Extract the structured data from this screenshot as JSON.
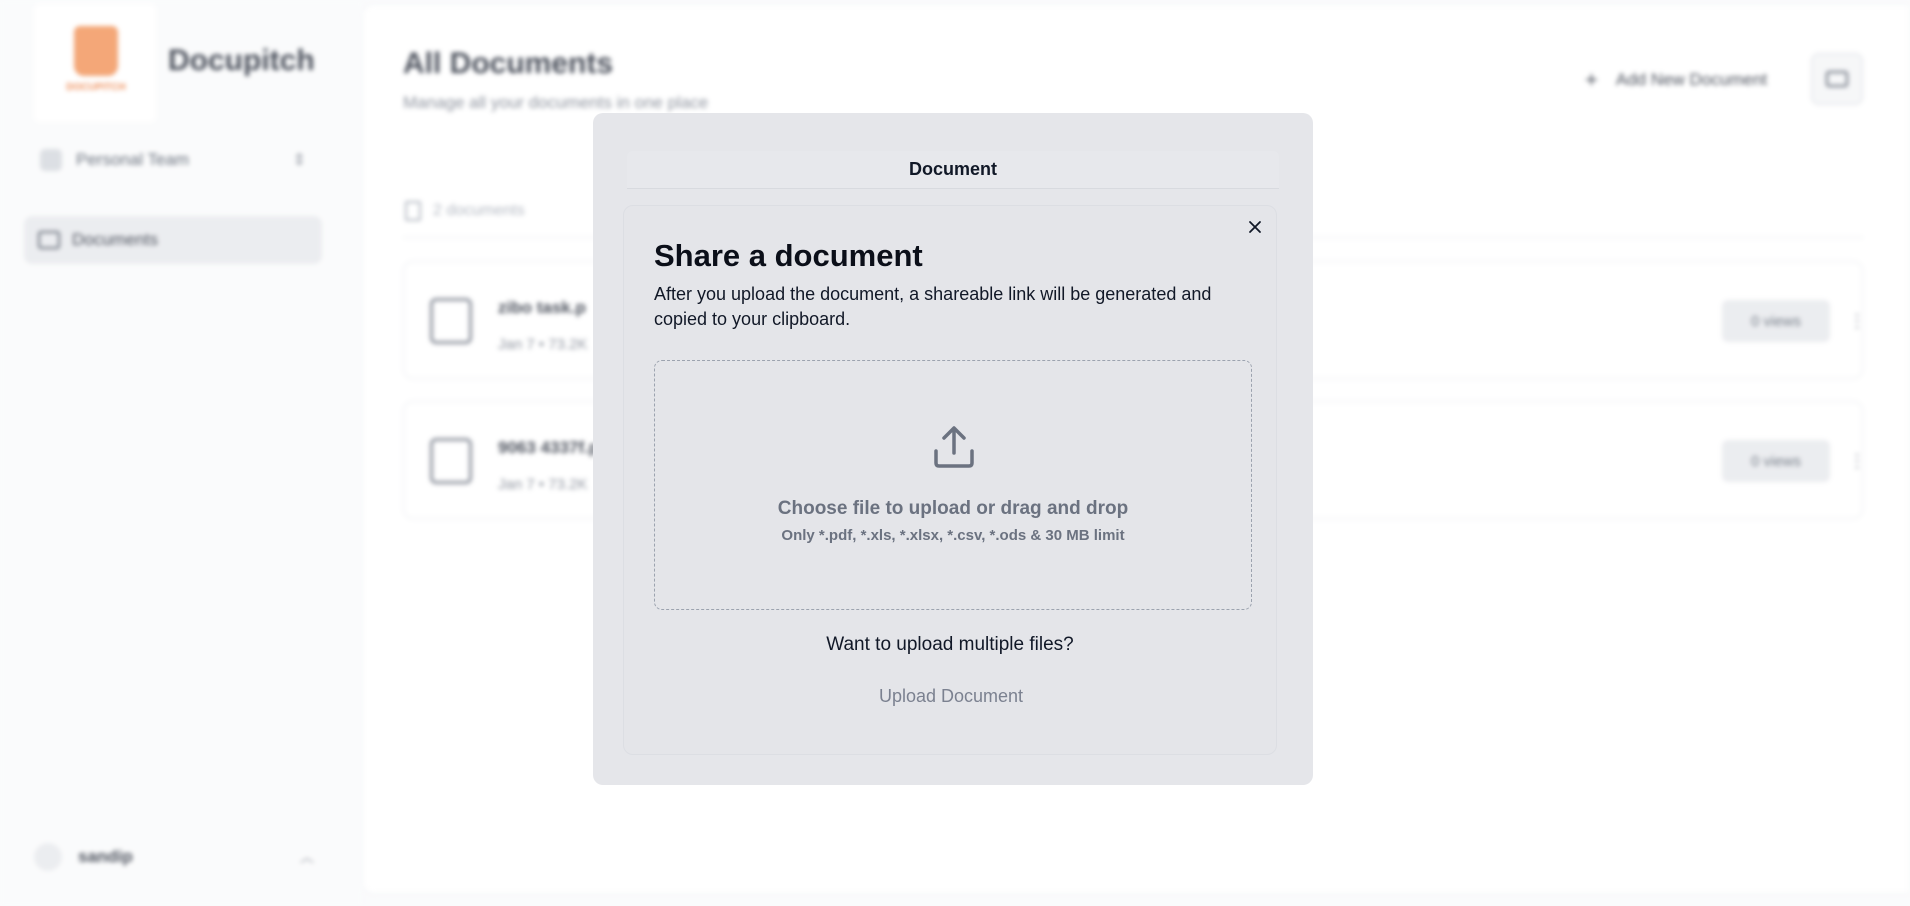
{
  "sidebar": {
    "brand": "Docupitch",
    "logo_text": "DOCUPITCH",
    "team": {
      "label": "Personal Team"
    },
    "nav": [
      {
        "label": "Documents"
      }
    ],
    "user": {
      "name": "sandip"
    }
  },
  "main": {
    "title": "All Documents",
    "subtitle": "Manage all your documents in one place",
    "add_button": "Add New Document",
    "doc_count": "2 documents",
    "documents": [
      {
        "name": "zibo task.p",
        "meta": "Jan 7 • 73.2K",
        "views": "0 views"
      },
      {
        "name": "9063 4337f.p",
        "meta": "Jan 7 • 73.2K",
        "views": "0 views"
      }
    ]
  },
  "modal": {
    "tab": "Document",
    "title": "Share a document",
    "description": "After you upload the document, a shareable link will be generated and copied to your clipboard.",
    "dropzone": {
      "main": "Choose file to upload or drag and drop",
      "sub": "Only *.pdf, *.xls, *.xlsx, *.csv, *.ods & 30 MB limit"
    },
    "multi_link": "Want to upload multiple files?",
    "upload_button": "Upload Document"
  }
}
